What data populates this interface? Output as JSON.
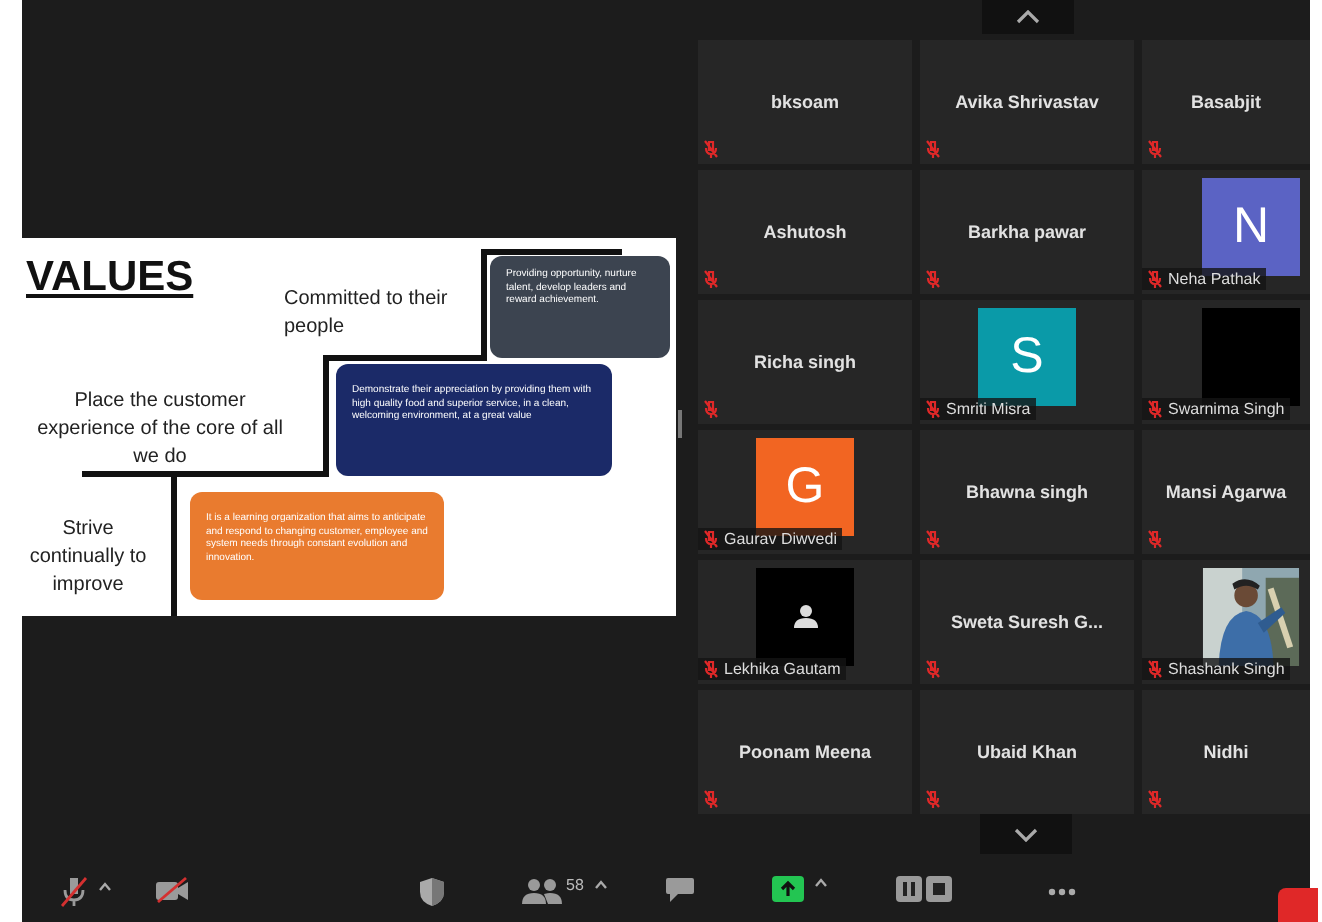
{
  "slide": {
    "title": "VALUES",
    "statements": [
      {
        "kind": "top",
        "text": "Committed to their people"
      },
      {
        "kind": "middle",
        "text": "Place the customer experience of the core of all we do"
      },
      {
        "kind": "bottom",
        "text": "Strive continually to improve"
      }
    ],
    "boxes": [
      {
        "kind": "top",
        "color": "#3c4450",
        "text": "Providing opportunity, nurture talent, develop leaders and reward achievement."
      },
      {
        "kind": "middle",
        "color": "#1b2a68",
        "text": "Demonstrate their appreciation by providing them with high quality food and superior service, in a clean, welcoming environment, at a great value"
      },
      {
        "kind": "bottom",
        "color": "#e97b2f",
        "text": "It is a learning organization that aims to anticipate and  respond to changing customer, employee and system needs through constant evolution and innovation."
      }
    ]
  },
  "participants": [
    {
      "kind": "name",
      "name": "bksoam",
      "muted": true
    },
    {
      "kind": "name",
      "name": "Avika Shrivastav",
      "muted": true
    },
    {
      "kind": "name",
      "name": "Basabjit",
      "muted": true
    },
    {
      "kind": "name",
      "name": "Ashutosh",
      "muted": true
    },
    {
      "kind": "name",
      "name": "Barkha pawar",
      "muted": true
    },
    {
      "kind": "avatar",
      "name": "Neha Pathak",
      "letter": "N",
      "color": "#5b63c4",
      "muted": true
    },
    {
      "kind": "name",
      "name": "Richa singh",
      "muted": true
    },
    {
      "kind": "avatar",
      "name": "Smriti Misra",
      "letter": "S",
      "color": "#0a9aa8",
      "muted": true
    },
    {
      "kind": "blank",
      "name": "Swarnima Singh",
      "muted": true
    },
    {
      "kind": "avatar",
      "name": "Gaurav Diwvedi",
      "letter": "G",
      "color": "#f26522",
      "muted": true
    },
    {
      "kind": "name",
      "name": "Bhawna singh",
      "muted": true
    },
    {
      "kind": "name",
      "name": "Mansi Agarwa",
      "muted": true
    },
    {
      "kind": "silhouette",
      "name": "Lekhika Gautam",
      "muted": true
    },
    {
      "kind": "name",
      "name": "Sweta  Suresh  G...",
      "muted": true
    },
    {
      "kind": "picture",
      "name": "Shashank Singh",
      "muted": true
    },
    {
      "kind": "name",
      "name": "Poonam Meena",
      "muted": true
    },
    {
      "kind": "name",
      "name": "Ubaid Khan",
      "muted": true
    },
    {
      "kind": "name",
      "name": "Nidhi",
      "muted": true
    }
  ],
  "toolbar": [
    {
      "kind": "mic"
    },
    {
      "kind": "video"
    },
    {
      "kind": "security"
    },
    {
      "kind": "participants",
      "count": "58"
    },
    {
      "kind": "chat"
    },
    {
      "kind": "share"
    },
    {
      "kind": "record"
    },
    {
      "kind": "more"
    },
    {
      "kind": "end"
    }
  ]
}
